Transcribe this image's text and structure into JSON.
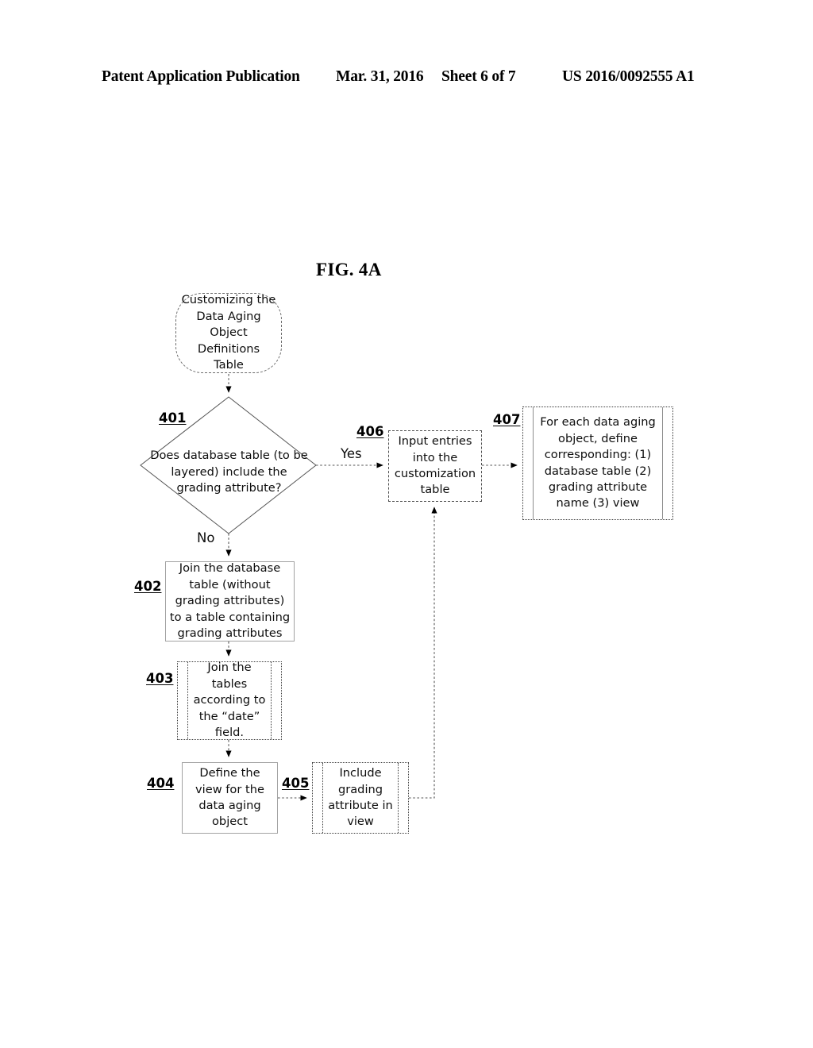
{
  "header": {
    "publication": "Patent Application Publication",
    "date": "Mar. 31, 2016",
    "sheet": "Sheet 6 of 7",
    "patent_number": "US 2016/0092555 A1"
  },
  "figure": {
    "title": "FIG. 4A"
  },
  "flowchart": {
    "start": {
      "text": "Customizing the Data Aging Object Definitions Table"
    },
    "nodes": [
      {
        "ref": "401",
        "shape": "decision",
        "text": "Does database table (to be layered) include the grading attribute?"
      },
      {
        "ref": "402",
        "shape": "process",
        "text": "Join the database table (without grading attributes) to a table containing grading attributes"
      },
      {
        "ref": "403",
        "shape": "process-multidoc",
        "text": "Join the tables according to the “date” field."
      },
      {
        "ref": "404",
        "shape": "process",
        "text": "Define the view for the data aging object"
      },
      {
        "ref": "405",
        "shape": "process-multidoc",
        "text": "Include grading attribute in view"
      },
      {
        "ref": "406",
        "shape": "process",
        "text": "Input entries into the customization table"
      },
      {
        "ref": "407",
        "shape": "process-multidoc",
        "text": "For each data aging object, define corresponding: (1) database table (2) grading attribute name (3) view"
      }
    ],
    "edge_labels": {
      "yes": "Yes",
      "no": "No"
    }
  },
  "colors": {
    "ink": "#000000",
    "line_gray": "#6b6b6b",
    "box_gray": "#a2a2a2",
    "background": "#ffffff"
  }
}
